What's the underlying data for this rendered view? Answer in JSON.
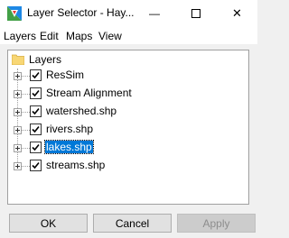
{
  "window": {
    "title": "Layer Selector - Hay...",
    "minimize_glyph": "—",
    "close_glyph": "✕"
  },
  "menu": [
    "Layers",
    "Edit",
    "Maps",
    "View"
  ],
  "tree": {
    "root_label": "Layers",
    "items": [
      {
        "label": "ResSim",
        "checked": true,
        "selected": false
      },
      {
        "label": "Stream Alignment",
        "checked": true,
        "selected": false
      },
      {
        "label": "watershed.shp",
        "checked": true,
        "selected": false
      },
      {
        "label": "rivers.shp",
        "checked": true,
        "selected": false
      },
      {
        "label": "lakes.shp",
        "checked": true,
        "selected": true
      },
      {
        "label": "streams.shp",
        "checked": true,
        "selected": false
      }
    ]
  },
  "buttons": {
    "ok": "OK",
    "cancel": "Cancel",
    "apply": "Apply"
  },
  "colors": {
    "selection": "#0078d7",
    "folder": "#f8d775"
  }
}
